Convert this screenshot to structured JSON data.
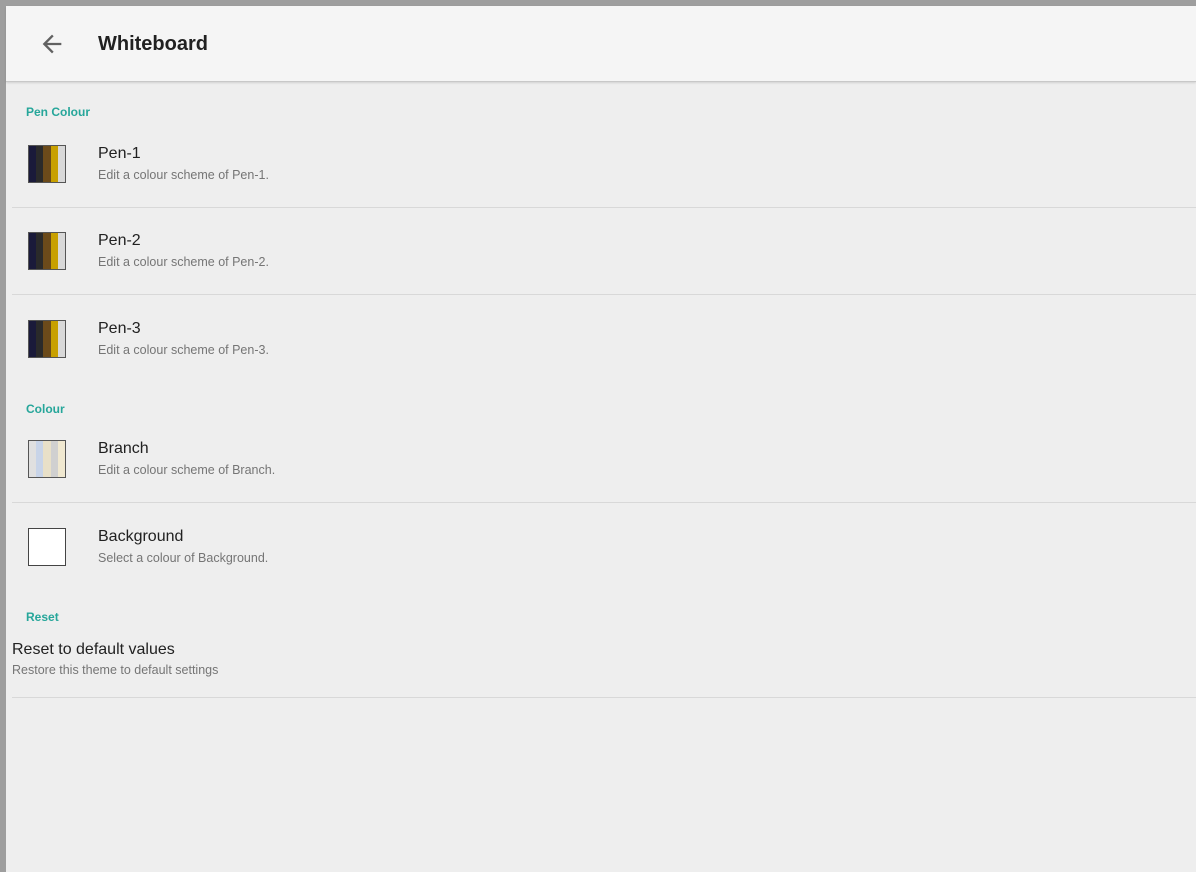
{
  "appbar": {
    "back_icon": "arrow-left-icon",
    "title": "Whiteboard"
  },
  "sections": {
    "pen_colour": {
      "header": "Pen Colour",
      "items": [
        {
          "title": "Pen-1",
          "subtitle": "Edit a colour scheme of Pen-1."
        },
        {
          "title": "Pen-2",
          "subtitle": "Edit a colour scheme of Pen-2."
        },
        {
          "title": "Pen-3",
          "subtitle": "Edit a colour scheme of Pen-3."
        }
      ]
    },
    "colour": {
      "header": "Colour",
      "items": [
        {
          "title": "Branch",
          "subtitle": "Edit a colour scheme of Branch."
        },
        {
          "title": "Background",
          "subtitle": "Select a colour of Background."
        }
      ]
    },
    "reset": {
      "header": "Reset",
      "item": {
        "title": "Reset to default values",
        "subtitle": "Restore this theme to default settings"
      }
    }
  },
  "colors": {
    "accent": "#26a69a",
    "pen_swatch": [
      "#1a1a3a",
      "#2a2a2a",
      "#6b4a1a",
      "#c8a000",
      "#d8d8d8"
    ],
    "branch_swatch": [
      "#e0e0e0",
      "#c8d4e8",
      "#e8e0c8",
      "#d0d0d0",
      "#f0e8d0"
    ],
    "background_swatch": "#ffffff"
  }
}
